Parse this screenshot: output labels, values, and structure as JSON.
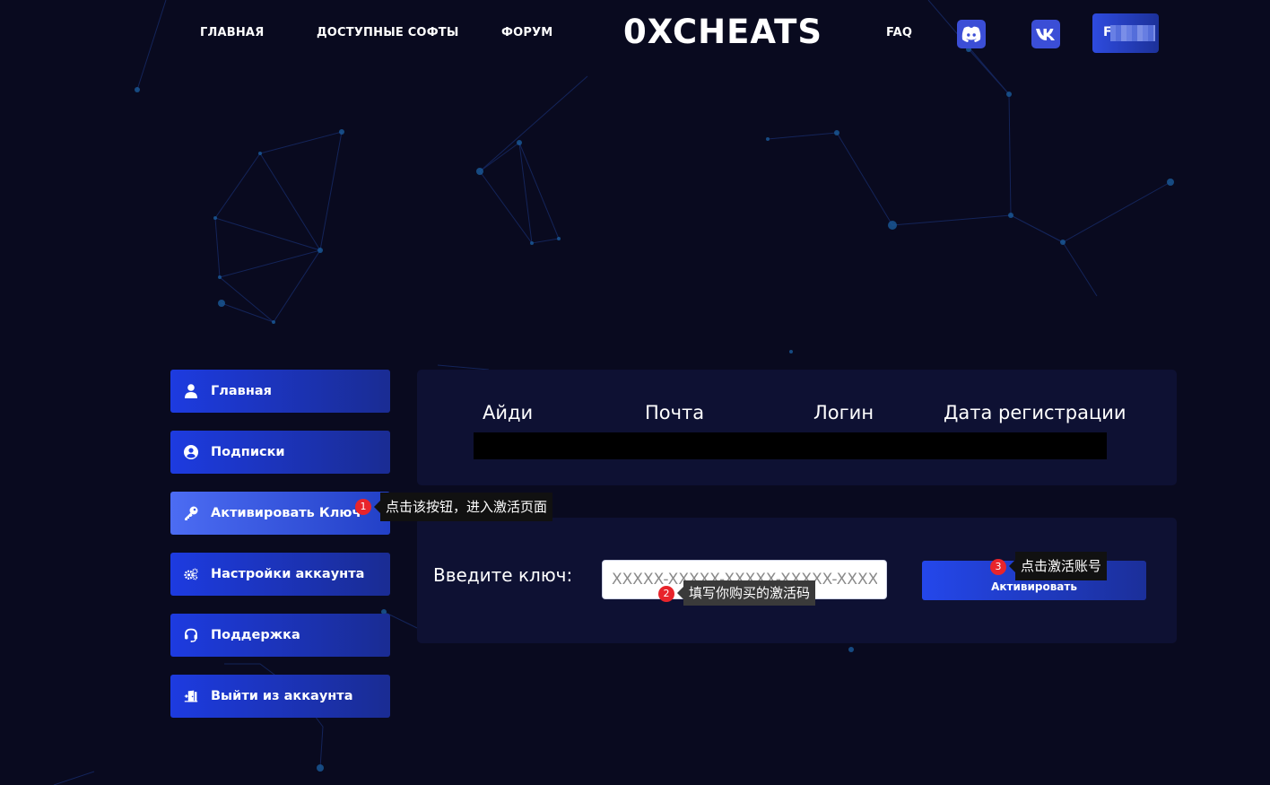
{
  "nav": {
    "home": "ГЛАВНАЯ",
    "software": "ДОСТУПНЫЕ СОФТЫ",
    "forum": "ФОРУМ",
    "logo": "0XCHEATS",
    "faq": "FAQ",
    "discord_icon": "discord-icon",
    "vk_icon": "vk-icon",
    "user_initial": "F"
  },
  "sidebar": {
    "items": [
      {
        "label": "Главная",
        "icon": "user-icon"
      },
      {
        "label": "Подписки",
        "icon": "user-circle-icon"
      },
      {
        "label": "Активировать Ключ",
        "icon": "key-icon"
      },
      {
        "label": "Настройки аккаунта",
        "icon": "gears-icon"
      },
      {
        "label": "Поддержка",
        "icon": "headset-icon"
      },
      {
        "label": "Выйти из аккаунта",
        "icon": "door-exit-icon"
      }
    ],
    "active_index": 2
  },
  "profile_table": {
    "columns": [
      "Айди",
      "Почта",
      "Логин",
      "Дата регистрации"
    ]
  },
  "activation": {
    "label": "Введите ключ:",
    "placeholder": "XXXXX-XXXXX-XXXXX-XXXXX-XXXXX",
    "button": "Активировать"
  },
  "annotations": [
    {
      "number": "1",
      "text": "点击该按钮，进入激活页面"
    },
    {
      "number": "2",
      "text": "填写你购买的激活码"
    },
    {
      "number": "3",
      "text": "点击激活账号"
    }
  ],
  "colors": {
    "background": "#090a1f",
    "panel": "#0e1133",
    "accent": "#1d3be0",
    "badge": "#e8242b"
  }
}
